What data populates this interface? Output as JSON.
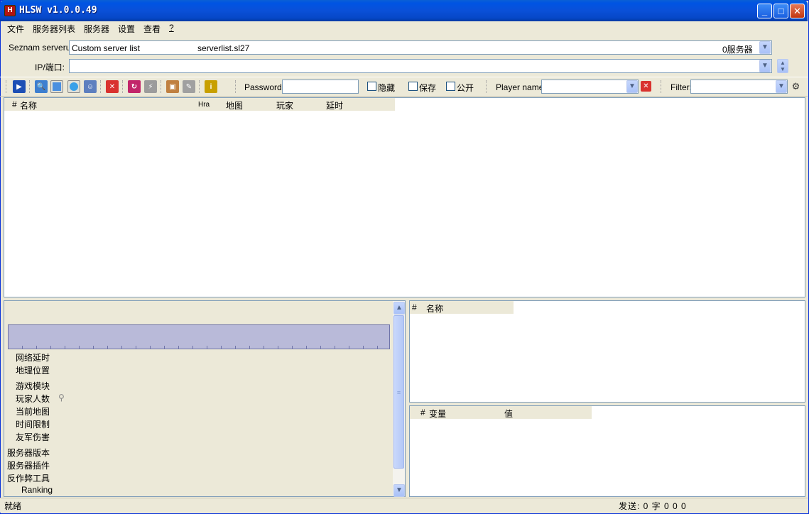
{
  "window": {
    "title": "HLSW v1.0.0.49",
    "icon": "hlsw-app-icon"
  },
  "title_buttons": {
    "minimize": "_",
    "maximize": "□",
    "close": "✕"
  },
  "menu": [
    "文件",
    "服务器列表",
    "服务器",
    "设置",
    "查看",
    "?"
  ],
  "server_list_row": {
    "label": "Seznam serveru:",
    "name": "Custom server list",
    "file": "serverlist.sl27",
    "count": "0服务器"
  },
  "ip_row": {
    "label": "IP/端口:",
    "value": ""
  },
  "toolbar": {
    "password_label": "Password:",
    "checkboxes": [
      "隐藏",
      "保存",
      "公开"
    ],
    "player_label": "Player name:",
    "filter_label": "Filter:"
  },
  "server_table": {
    "headers": [
      "#",
      "名称",
      "Hra",
      "地图",
      "玩家",
      "延时"
    ]
  },
  "info_panel": {
    "labels_indented": [
      "网络延时",
      "地理位置",
      "游戏模块",
      "玩家人数",
      "当前地图",
      "时间限制",
      "友军伤害"
    ],
    "labels": [
      "服务器版本",
      "服务器插件",
      "反作弊工具"
    ],
    "ranking": "Ranking"
  },
  "players_table": {
    "headers": [
      "#",
      "名称"
    ]
  },
  "vars_table": {
    "headers": [
      "#",
      "变量",
      "值"
    ]
  },
  "status": {
    "left": "就绪",
    "right": "发送: 0 字 0 0 0"
  },
  "colors": {
    "graph": "#b9bad9",
    "titlebar": "#0054e3"
  }
}
